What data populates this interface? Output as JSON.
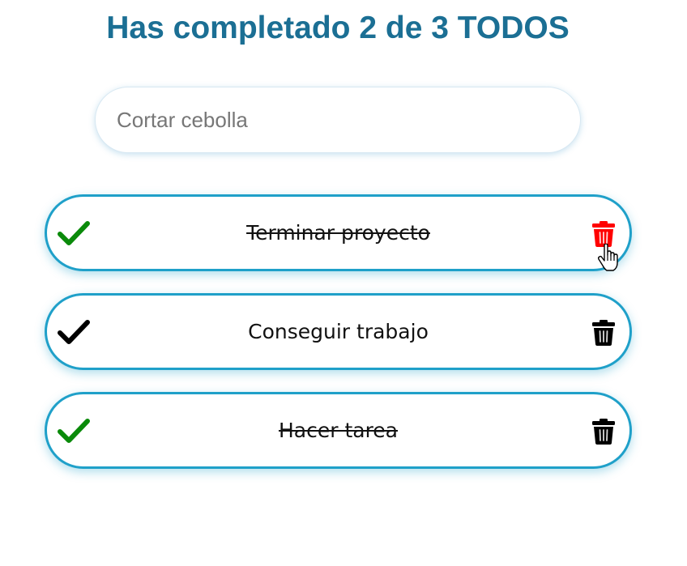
{
  "header": {
    "title": "Has completado 2 de 3 TODOS"
  },
  "search": {
    "value": "",
    "placeholder": "Cortar cebolla"
  },
  "todos": [
    {
      "text": "Terminar proyecto",
      "completed": true,
      "check_color": "#0a8a0a",
      "trash_color": "#ff0000",
      "check_icon": "check-icon",
      "trash_icon": "trash-icon"
    },
    {
      "text": "Conseguir trabajo",
      "completed": false,
      "check_color": "#000000",
      "trash_color": "#000000",
      "check_icon": "check-icon",
      "trash_icon": "trash-icon"
    },
    {
      "text": "Hacer tarea",
      "completed": true,
      "check_color": "#0a8a0a",
      "trash_color": "#000000",
      "check_icon": "check-icon",
      "trash_icon": "trash-icon"
    }
  ],
  "colors": {
    "title": "#1b6f94",
    "item_border": "#1fa0c9",
    "completed_check": "#0a8a0a",
    "hover_trash": "#ff0000"
  },
  "cursor": {
    "icon": "hand-pointer-cursor"
  }
}
